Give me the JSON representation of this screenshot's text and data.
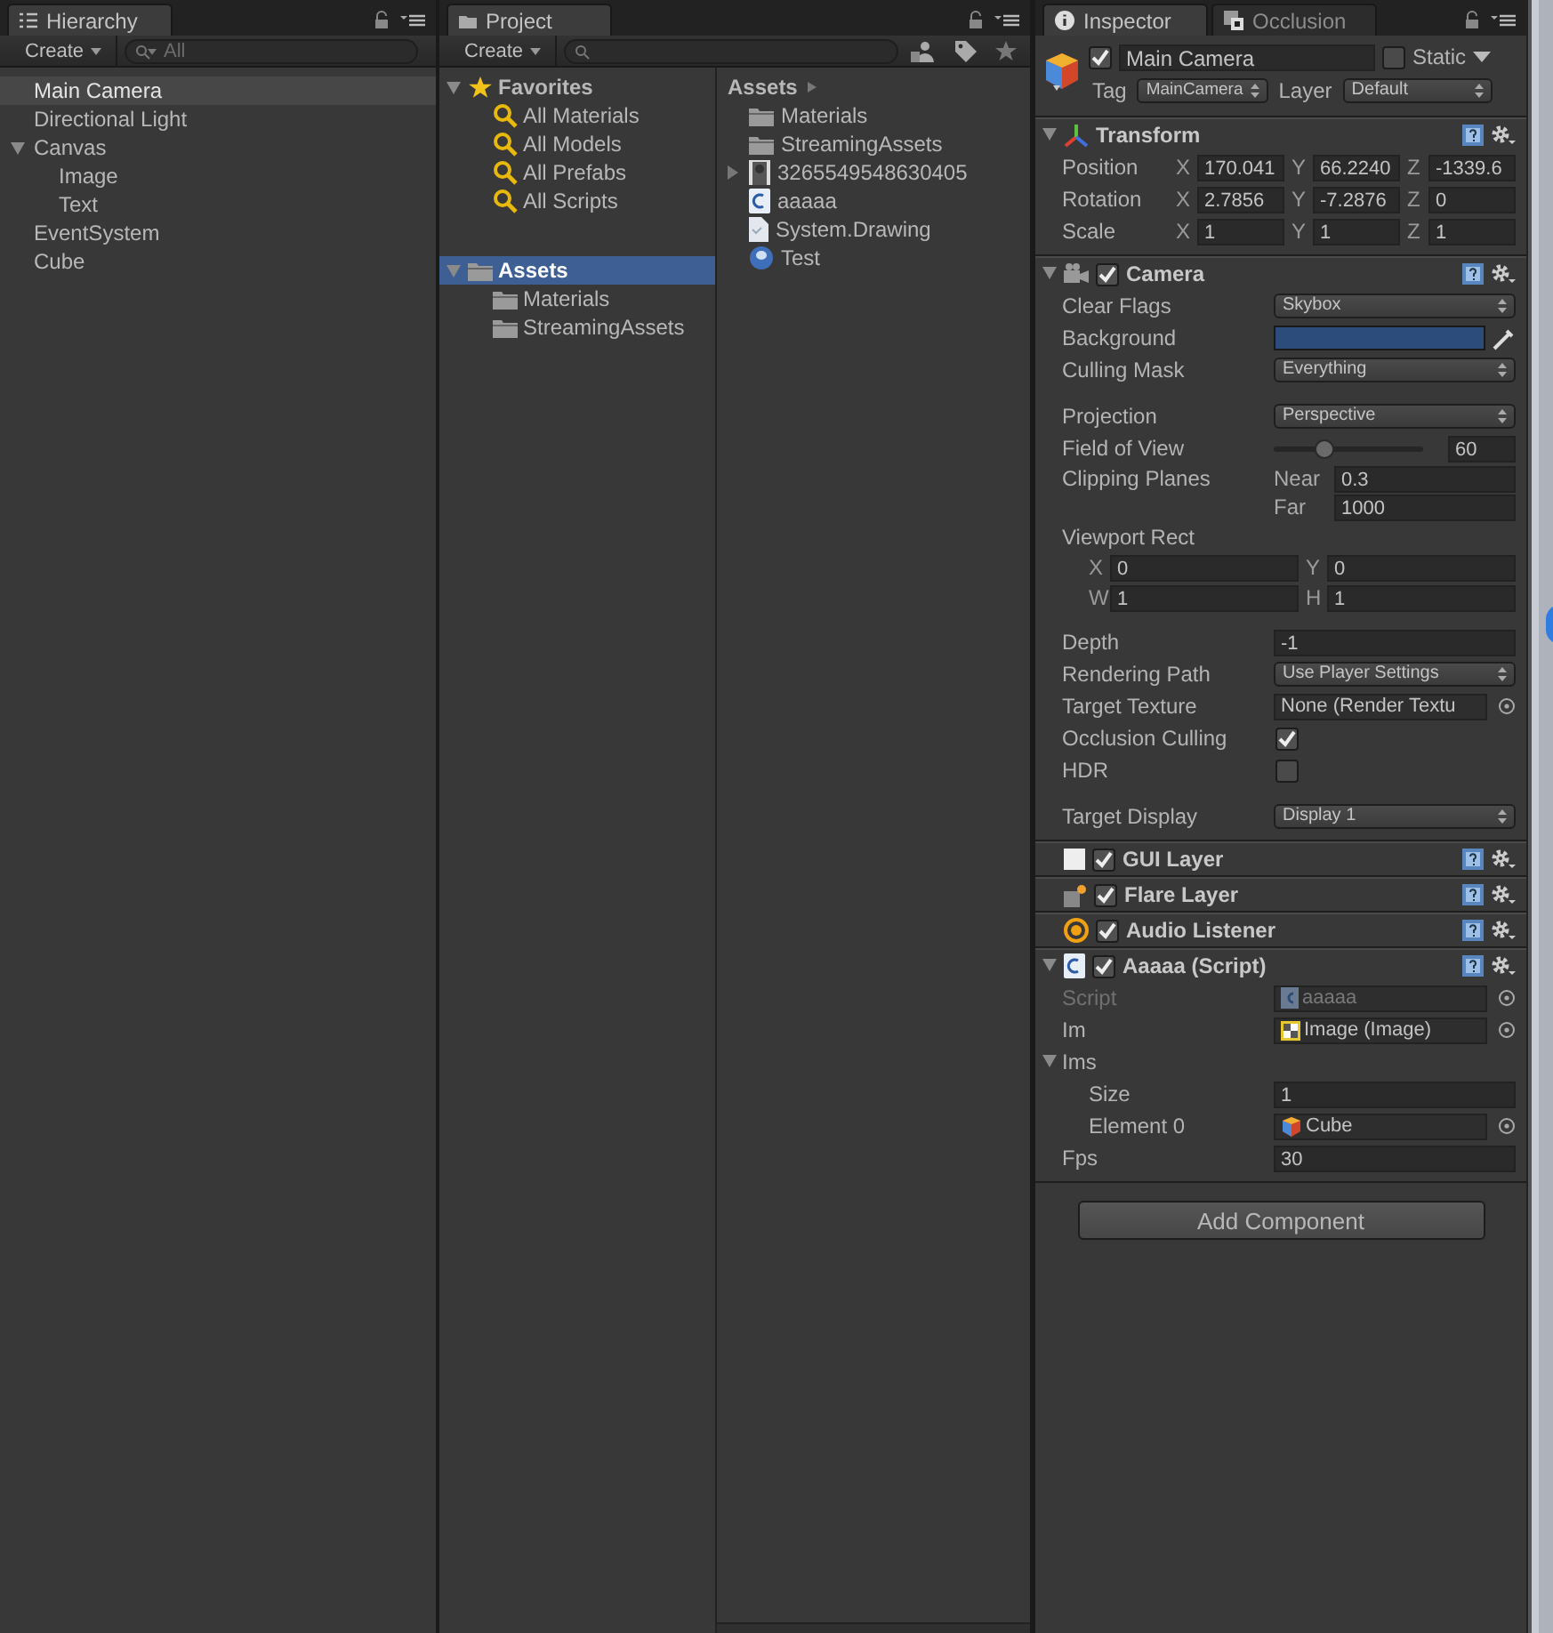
{
  "hierarchy": {
    "title": "Hierarchy",
    "create": "Create",
    "search": {
      "placeholder": "All"
    },
    "items": [
      {
        "label": "Main Camera",
        "selected": true
      },
      {
        "label": "Directional Light",
        "selected": false
      },
      {
        "label": "Canvas",
        "selected": false,
        "expanded": true,
        "children": [
          {
            "label": "Image",
            "selected": false
          },
          {
            "label": "Text",
            "selected": false
          }
        ]
      },
      {
        "label": "EventSystem",
        "selected": false
      },
      {
        "label": "Cube",
        "selected": false
      }
    ]
  },
  "project": {
    "title": "Project",
    "create": "Create",
    "folders": [
      {
        "label": "Favorites",
        "kind": "favorites",
        "selected": false,
        "expanded": true,
        "children": [
          {
            "label": "All Materials",
            "kind": "search",
            "selected": false
          },
          {
            "label": "All Models",
            "kind": "search",
            "selected": false
          },
          {
            "label": "All Prefabs",
            "kind": "search",
            "selected": false
          },
          {
            "label": "All Scripts",
            "kind": "search",
            "selected": false
          }
        ]
      },
      {
        "label": "Assets",
        "kind": "folder",
        "selected": true,
        "expanded": true,
        "children": [
          {
            "label": "Materials",
            "kind": "folder",
            "selected": false
          },
          {
            "label": "StreamingAssets",
            "kind": "folder",
            "selected": false
          }
        ]
      }
    ],
    "breadcrumb": "Assets",
    "files": [
      {
        "name": "Materials",
        "kind": "folder",
        "expandable": false,
        "selected": false
      },
      {
        "name": "StreamingAssets",
        "kind": "folder",
        "expandable": false,
        "selected": false
      },
      {
        "name": "3265549548630405",
        "kind": "texture",
        "expandable": true,
        "selected": false
      },
      {
        "name": "aaaaa",
        "kind": "script",
        "expandable": false,
        "selected": false
      },
      {
        "name": "System.Drawing",
        "kind": "dll",
        "expandable": false,
        "selected": false
      },
      {
        "name": "Test",
        "kind": "scene",
        "expandable": false,
        "selected": false
      }
    ]
  },
  "inspector": {
    "tabs": [
      {
        "label": "Inspector",
        "selected": true
      },
      {
        "label": "Occlusion",
        "selected": false
      }
    ],
    "object": {
      "active": true,
      "name": "Main Camera",
      "static_label": "Static",
      "static": false,
      "tag_label": "Tag",
      "tag": "MainCamera",
      "layer_label": "Layer",
      "layer": "Default"
    },
    "components": [
      {
        "kind": "transform",
        "title": "Transform",
        "expanded": true,
        "rows": [
          {
            "label": "Position",
            "fields": [
              {
                "axis": "X",
                "value": "170.041"
              },
              {
                "axis": "Y",
                "value": "66.2240"
              },
              {
                "axis": "Z",
                "value": "-1339.6"
              }
            ]
          },
          {
            "label": "Rotation",
            "fields": [
              {
                "axis": "X",
                "value": "2.7856"
              },
              {
                "axis": "Y",
                "value": "-7.2876"
              },
              {
                "axis": "Z",
                "value": "0"
              }
            ]
          },
          {
            "label": "Scale",
            "fields": [
              {
                "axis": "X",
                "value": "1"
              },
              {
                "axis": "Y",
                "value": "1"
              },
              {
                "axis": "Z",
                "value": "1"
              }
            ]
          }
        ]
      },
      {
        "kind": "camera",
        "title": "Camera",
        "enabled": true,
        "expanded": true,
        "properties": [
          {
            "kind": "dropdown",
            "label": "Clear Flags",
            "value": "Skybox"
          },
          {
            "kind": "color",
            "label": "Background",
            "color": "#2c4c7c"
          },
          {
            "kind": "dropdown",
            "label": "Culling Mask",
            "value": "Everything"
          },
          {
            "kind": "dropdown",
            "label": "Projection",
            "value": "Perspective",
            "gap_before": true
          },
          {
            "kind": "slider",
            "label": "Field of View",
            "level": 0.34,
            "value": "60"
          },
          {
            "kind": "pair",
            "label": "Clipping Planes",
            "fields": [
              {
                "axis": "Near",
                "value": "0.3"
              },
              {
                "axis": "Far",
                "value": "1000"
              }
            ]
          },
          {
            "kind": "rect",
            "label": "Viewport Rect",
            "fields": [
              {
                "axis": "X",
                "value": "0"
              },
              {
                "axis": "Y",
                "value": "0"
              },
              {
                "axis": "W",
                "value": "1"
              },
              {
                "axis": "H",
                "value": "1"
              }
            ]
          },
          {
            "kind": "text",
            "label": "Depth",
            "value": "-1",
            "gap_before": true
          },
          {
            "kind": "dropdown",
            "label": "Rendering Path",
            "value": "Use Player Settings"
          },
          {
            "kind": "object",
            "label": "Target Texture",
            "value": "None (Render Textu"
          },
          {
            "kind": "checkbox",
            "label": "Occlusion Culling",
            "checked": true
          },
          {
            "kind": "checkbox",
            "label": "HDR",
            "checked": false
          },
          {
            "kind": "dropdown",
            "label": "Target Display",
            "value": "Display 1",
            "gap_before": true
          }
        ]
      },
      {
        "kind": "gui_layer",
        "title": "GUI Layer",
        "enabled": true
      },
      {
        "kind": "flare_layer",
        "title": "Flare Layer",
        "enabled": true
      },
      {
        "kind": "audio_listener",
        "title": "Audio Listener",
        "enabled": true
      },
      {
        "kind": "script",
        "title": "Aaaaa (Script)",
        "enabled": true,
        "expanded": true,
        "properties": [
          {
            "kind": "object_script",
            "label": "Script",
            "value": "aaaaa",
            "disabled": true
          },
          {
            "kind": "object_sprite",
            "label": "Im",
            "value": "Image (Image)"
          },
          {
            "kind": "foldout",
            "label": "Ims",
            "expanded": true,
            "children": [
              {
                "kind": "text",
                "label": "Size",
                "value": "1"
              },
              {
                "kind": "object_prefab",
                "label": "Element 0",
                "value": "Cube"
              }
            ]
          },
          {
            "kind": "text",
            "label": "Fps",
            "value": "30"
          }
        ]
      }
    ],
    "add_component": "Add Component"
  }
}
